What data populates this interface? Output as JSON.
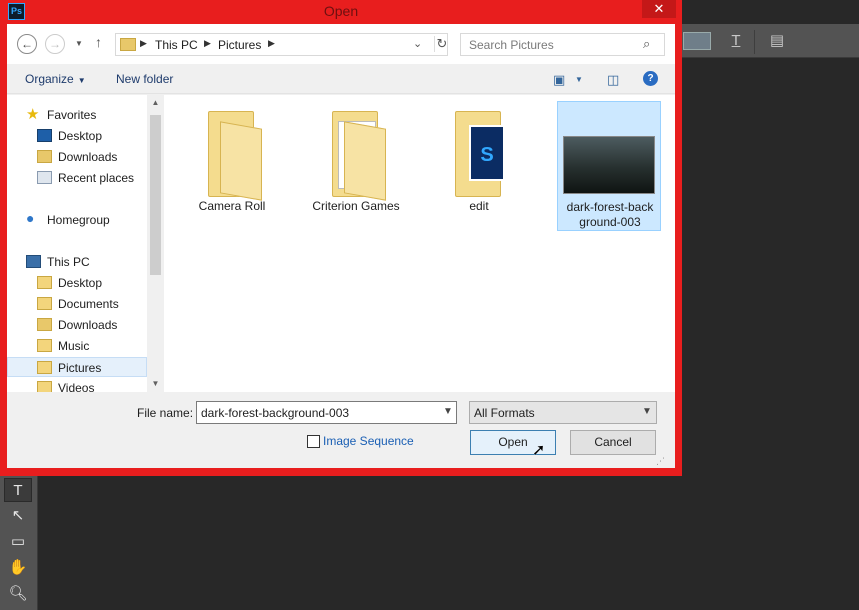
{
  "app": {
    "title": "Open",
    "logo": "Ps"
  },
  "colors": {
    "dialog_border": "#e81e1e",
    "accent": "#1a5fb4",
    "selected": "#cce8ff"
  },
  "nav": {
    "back_icon": "arrow-left-icon",
    "forward_icon": "arrow-right-icon",
    "up_icon": "arrow-up-icon",
    "breadcrumb": [
      "This PC",
      "Pictures"
    ],
    "search_placeholder": "Search Pictures"
  },
  "commands": {
    "organize": "Organize",
    "new_folder": "New folder"
  },
  "sidebar": {
    "items": [
      {
        "label": "Favorites"
      },
      {
        "label": "Desktop"
      },
      {
        "label": "Downloads"
      },
      {
        "label": "Recent places"
      },
      {
        "label": "Homegroup"
      },
      {
        "label": "This PC"
      },
      {
        "label": "Desktop"
      },
      {
        "label": "Documents"
      },
      {
        "label": "Downloads"
      },
      {
        "label": "Music"
      },
      {
        "label": "Pictures"
      },
      {
        "label": "Videos"
      }
    ],
    "selected": "Pictures"
  },
  "files": [
    {
      "name": "Camera Roll",
      "kind": "folder"
    },
    {
      "name": "Criterion Games",
      "kind": "folder"
    },
    {
      "name": "edit",
      "kind": "folder"
    },
    {
      "name": "dark-forest-back ground-003",
      "kind": "image",
      "selected": true
    }
  ],
  "bottom": {
    "file_name_label": "File name:",
    "file_name_value": "dark-forest-background-003",
    "format_value": "All Formats",
    "image_sequence_label": "Image Sequence",
    "open_label": "Open",
    "cancel_label": "Cancel"
  }
}
